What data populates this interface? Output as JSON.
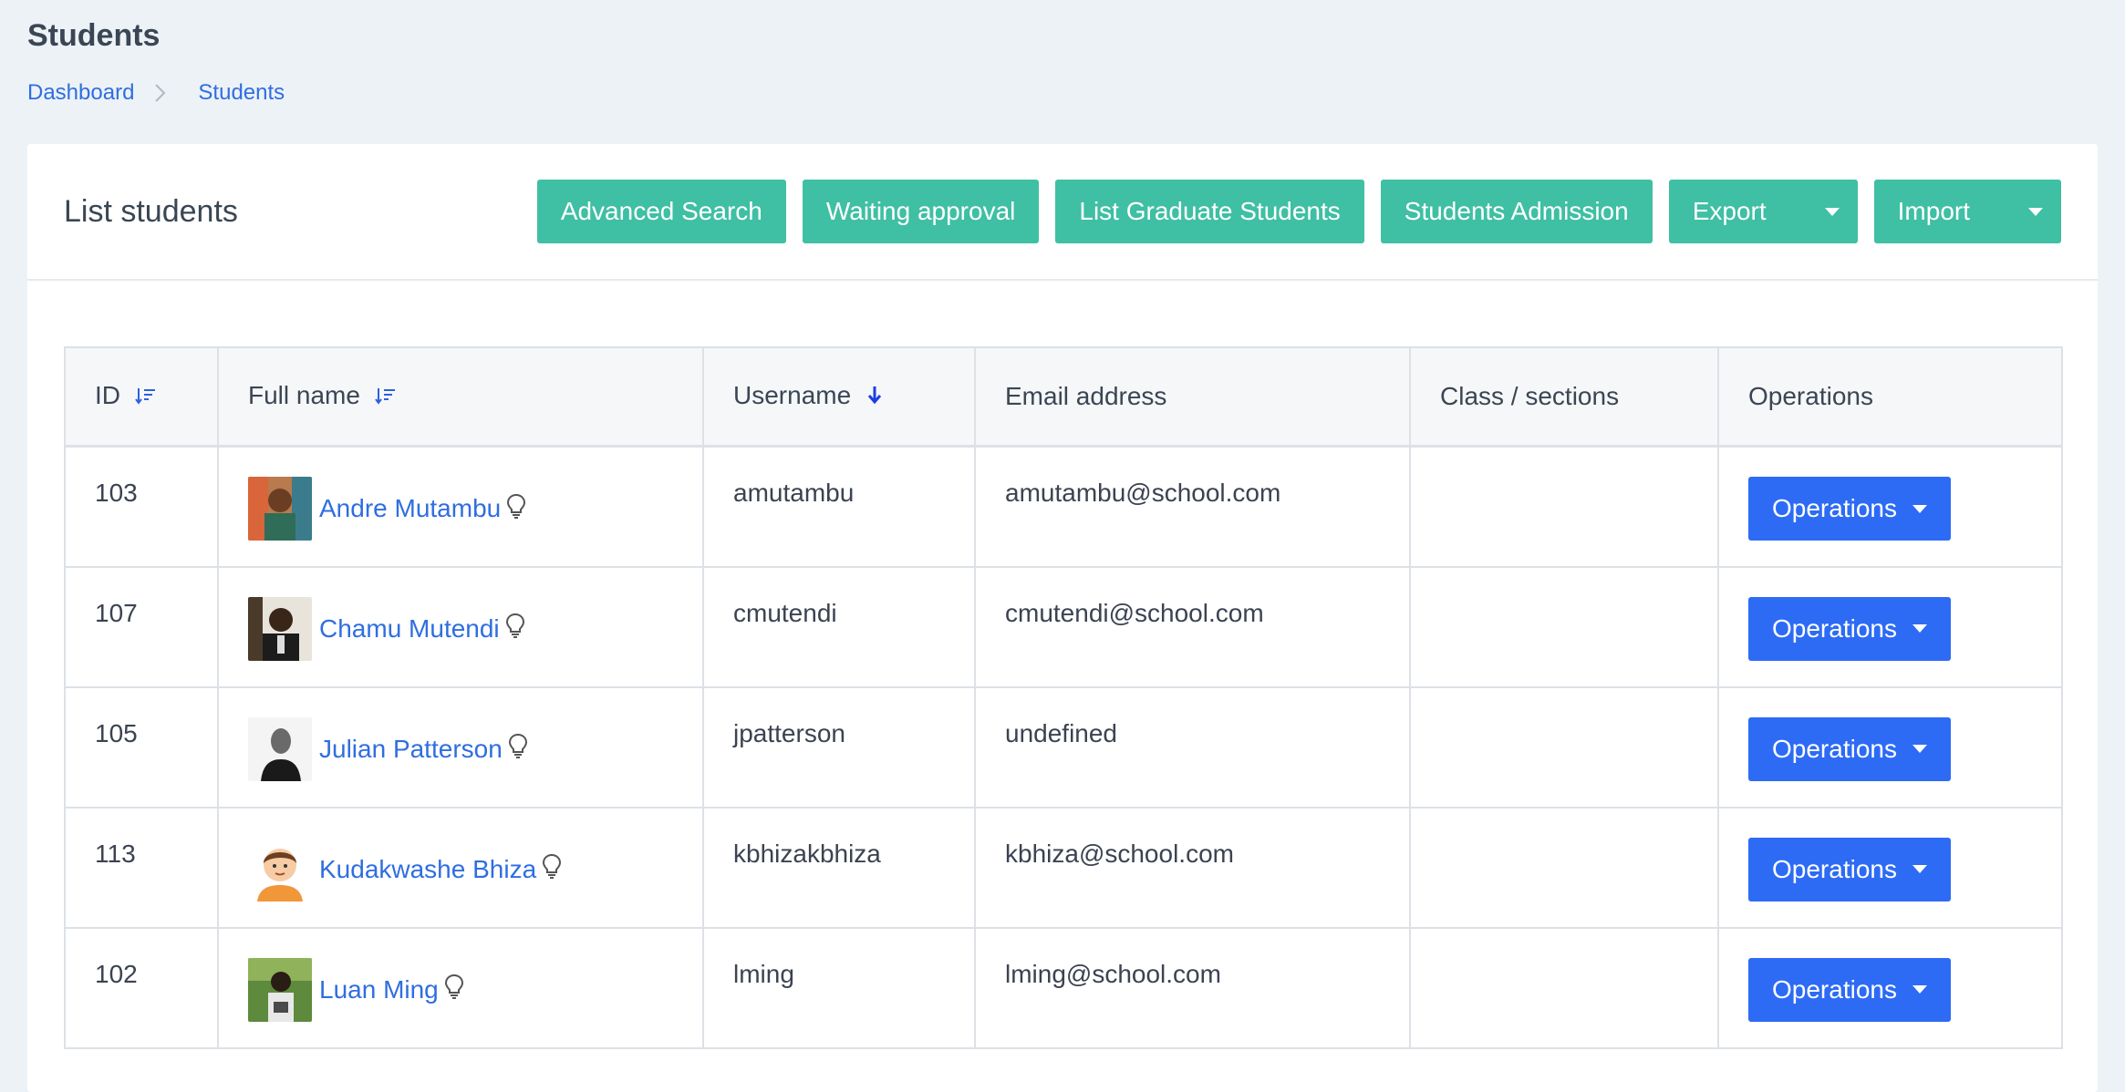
{
  "page": {
    "title": "Students",
    "breadcrumb": [
      "Dashboard",
      "Students"
    ]
  },
  "card": {
    "title": "List students",
    "buttons": {
      "advanced_search": "Advanced Search",
      "waiting_approval": "Waiting approval",
      "list_graduate": "List Graduate Students",
      "admission": "Students Admission",
      "export": "Export",
      "import": "Import"
    }
  },
  "table": {
    "headers": [
      "ID",
      "Full name",
      "Username",
      "Email address",
      "Class / sections",
      "Operations"
    ],
    "rows": [
      {
        "id": "103",
        "name": "Andre Mutambu",
        "username": "amutambu",
        "email": "amutambu@school.com",
        "class": "",
        "operations": "Operations"
      },
      {
        "id": "107",
        "name": "Chamu Mutendi",
        "username": "cmutendi",
        "email": "cmutendi@school.com",
        "class": "",
        "operations": "Operations"
      },
      {
        "id": "105",
        "name": "Julian Patterson",
        "username": "jpatterson",
        "email": "undefined",
        "class": "",
        "operations": "Operations"
      },
      {
        "id": "113",
        "name": "Kudakwashe Bhiza",
        "username": "kbhizakbhiza",
        "email": "kbhiza@school.com",
        "class": "",
        "operations": "Operations"
      },
      {
        "id": "102",
        "name": "Luan Ming",
        "username": "lming",
        "email": "lming@school.com",
        "class": "",
        "operations": "Operations"
      }
    ]
  },
  "colors": {
    "teal_button": "#3fbfa3",
    "blue_button": "#2d6bf5",
    "link": "#2f6ee0",
    "background": "#edf2f7"
  }
}
